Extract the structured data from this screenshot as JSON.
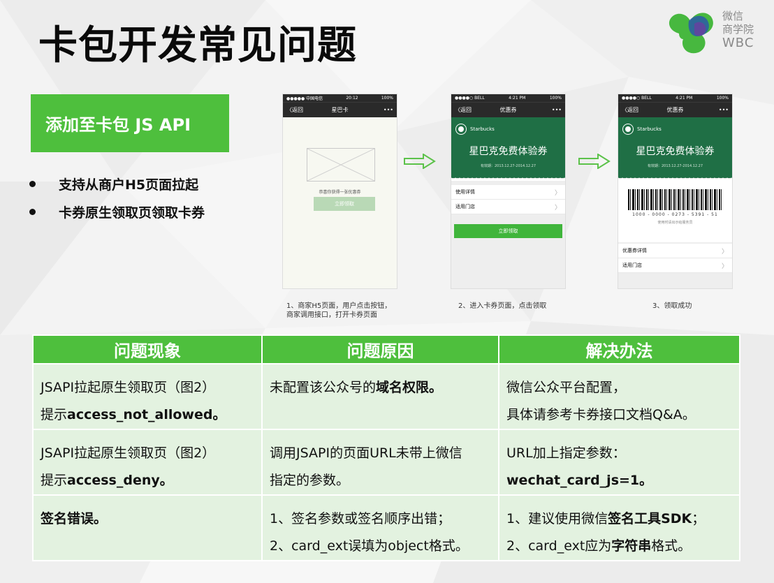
{
  "slide": {
    "title": "卡包开发常见问题",
    "logo": {
      "line1": "微信",
      "line2": "商学院",
      "line3": "WBC"
    },
    "api_button": "添加至卡包 JS API",
    "bullets": [
      "支持从商户H5页面拉起",
      "卡券原生领取页领取卡券"
    ]
  },
  "phones": {
    "p1": {
      "status_left": "●●●●● 中国电信",
      "status_time": "20:12",
      "status_right": "100%",
      "back": "〈返回",
      "nav_title": "星巴卡",
      "more": "•••",
      "message": "恭喜你获得一张优惠券",
      "button": "立即领取",
      "caption": "1、商家H5页面，用户点击按钮，商家调用接口，打开卡券页面"
    },
    "p2": {
      "status_left": "●●●●○ BELL",
      "status_time": "4:21 PM",
      "status_right": "100%",
      "back": "〈返回",
      "nav_title": "优惠券",
      "more": "•••",
      "brand": "Starbucks",
      "coupon_name": "星巴克免费体验券",
      "valid": "有效期：2013.12.27-2014.12.27",
      "rows": [
        "使用详情",
        "适用门店"
      ],
      "button": "立即领取",
      "caption": "2、进入卡券页面，点击领取"
    },
    "p3": {
      "status_left": "●●●●○ BELL",
      "status_time": "4:21 PM",
      "status_right": "100%",
      "back": "〈返回",
      "nav_title": "优惠券",
      "more": "•••",
      "brand": "Starbucks",
      "coupon_name": "星巴克免费体验券",
      "valid": "有效期：2013.12.27-2014.12.27",
      "barcode_number": "1000 - 0000 - 0273 - 5391 - 51",
      "barcode_note": "使用时请出示给服务员",
      "rows": [
        "优惠券详情",
        "适用门店"
      ],
      "caption": "3、领取成功"
    },
    "row_arrow": "〉"
  },
  "table": {
    "headers": [
      "问题现象",
      "问题原因",
      "解决办法"
    ],
    "rows": [
      {
        "symptom": {
          "l1": "JSAPI拉起原生领取页（图2）",
          "l2_pre": "提示",
          "l2_bold": "access_not_allowed。"
        },
        "cause": {
          "pre": "未配置该公众号的",
          "bold": "域名权限。"
        },
        "solution": {
          "l1": "微信公众平台配置，",
          "l2": "具体请参考卡券接口文档Q&A。"
        }
      },
      {
        "symptom": {
          "l1": "JSAPI拉起原生领取页（图2）",
          "l2_pre": "提示",
          "l2_bold": "access_deny。"
        },
        "cause": {
          "l1": "调用JSAPI的页面URL未带上微信",
          "l2": "指定的参数。"
        },
        "solution": {
          "l1": "URL加上指定参数：",
          "l2_bold": "wechat_card_js=1。"
        }
      },
      {
        "symptom": {
          "bold": "签名错误。"
        },
        "cause": {
          "l1": "1、签名参数或签名顺序出错；",
          "l2": "2、card_ext误填为object格式。"
        },
        "solution": {
          "l1_pre": "1、建议使用微信",
          "l1_bold": "签名工具SDK",
          "l1_post": "；",
          "l2_pre": "2、card_ext应为",
          "l2_bold": "字符串",
          "l2_post": "格式。"
        }
      }
    ]
  },
  "colors": {
    "accent": "#4ebf3d",
    "cell_bg": "#e3f2e0",
    "coupon_green": "#1f6f45"
  }
}
